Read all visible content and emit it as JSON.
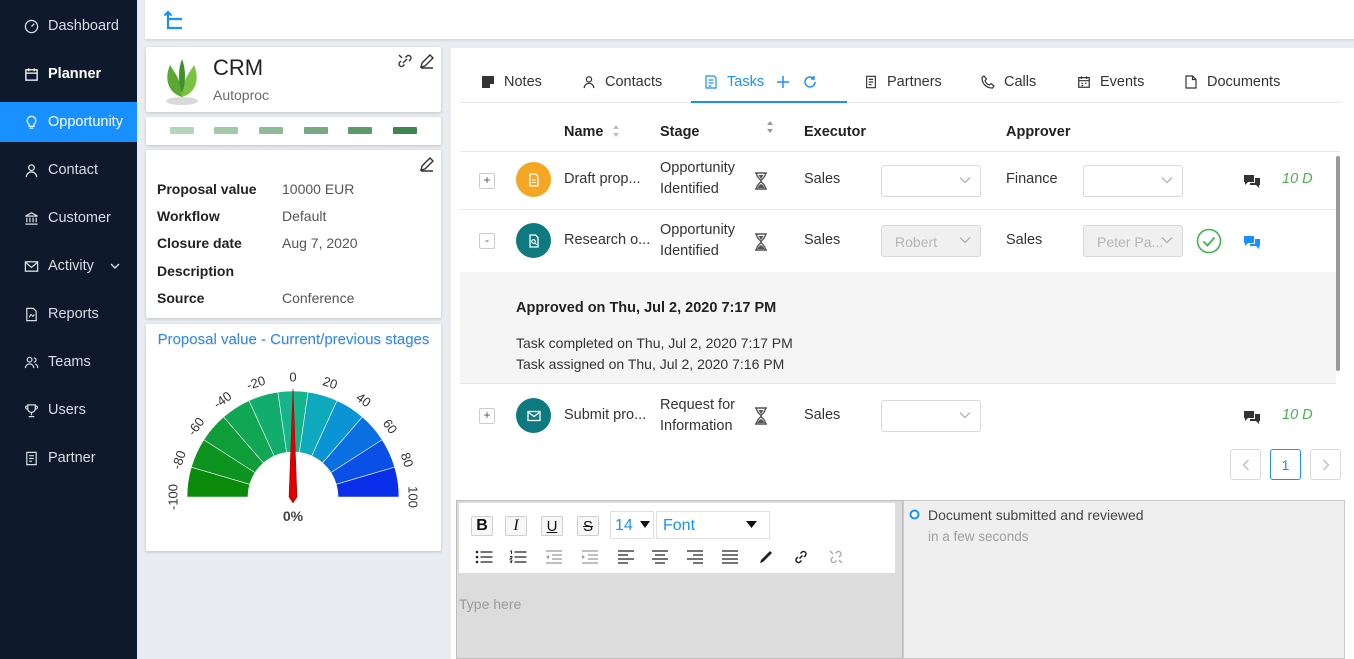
{
  "sidebar": {
    "items": [
      {
        "label": "Dashboard",
        "icon": "gauge-icon"
      },
      {
        "label": "Planner",
        "icon": "calendar-icon"
      },
      {
        "label": "Opportunity",
        "icon": "lightbulb-icon"
      },
      {
        "label": "Contact",
        "icon": "person-icon"
      },
      {
        "label": "Customer",
        "icon": "bank-icon"
      },
      {
        "label": "Activity",
        "icon": "mail-icon"
      },
      {
        "label": "Reports",
        "icon": "report-icon"
      },
      {
        "label": "Teams",
        "icon": "team-icon"
      },
      {
        "label": "Users",
        "icon": "trophy-icon"
      },
      {
        "label": "Partner",
        "icon": "partner-icon"
      }
    ],
    "active": "Opportunity"
  },
  "opportunity": {
    "title": "CRM",
    "subtitle": "Autoproc",
    "stage_colors": [
      "#b4d4bc",
      "#a3c9ac",
      "#8fbb9b",
      "#76a984",
      "#5c9a6c",
      "#3f8452"
    ],
    "details": [
      {
        "key": "Proposal value",
        "value": "10000 EUR"
      },
      {
        "key": "Workflow",
        "value": "Default"
      },
      {
        "key": "Closure date",
        "value": "Aug 7, 2020"
      },
      {
        "key": "Description",
        "value": ""
      },
      {
        "key": "Source",
        "value": "Conference"
      }
    ]
  },
  "gauge": {
    "title": "Proposal value - Current/previous stages",
    "min": -100,
    "max": 100,
    "ticks": [
      "-100",
      "-80",
      "-60",
      "-40",
      "-20",
      "0",
      "20",
      "40",
      "60",
      "80",
      "100"
    ],
    "value": 0,
    "value_label": "0%",
    "segment_colors": [
      "#0a8a0a",
      "#0d9420",
      "#0f9d3a",
      "#10a653",
      "#12ad6e",
      "#14b58a",
      "#0fa9bd",
      "#0a94d4",
      "#0a6fe0",
      "#0a4fe6",
      "#0a2fea"
    ]
  },
  "tabs": [
    {
      "label": "Notes",
      "icon": "note-icon"
    },
    {
      "label": "Contacts",
      "icon": "person-icon"
    },
    {
      "label": "Tasks",
      "icon": "task-icon"
    },
    {
      "label": "Partners",
      "icon": "partner-icon"
    },
    {
      "label": "Calls",
      "icon": "phone-icon"
    },
    {
      "label": "Events",
      "icon": "calendar-icon"
    },
    {
      "label": "Documents",
      "icon": "document-icon"
    }
  ],
  "active_tab": "Tasks",
  "table": {
    "columns": {
      "name": "Name",
      "stage": "Stage",
      "executor": "Executor",
      "approver": "Approver"
    },
    "rows": [
      {
        "expander": "+",
        "avatar_color": "#f5a623",
        "avatar_icon": "document-icon",
        "name": "Draft prop...",
        "stage_line1": "Opportunity",
        "stage_line2": "Identified",
        "executor_team": "Sales",
        "executor_user": "",
        "approver_team": "Finance",
        "approver_user": "",
        "due": "10 D"
      },
      {
        "expander": "-",
        "avatar_color": "#0e7a80",
        "avatar_icon": "search-doc-icon",
        "name": "Research o...",
        "stage_line1": "Opportunity",
        "stage_line2": "Identified",
        "executor_team": "Sales",
        "executor_user": "Robert",
        "approver_team": "Sales",
        "approver_user": "Peter Pa...",
        "due": ""
      },
      {
        "expander": "+",
        "avatar_color": "#0e7a80",
        "avatar_icon": "mail-icon",
        "name": "Submit pro...",
        "stage_line1": "Request for",
        "stage_line2": "Information",
        "executor_team": "Sales",
        "executor_user": "",
        "approver_team": "",
        "approver_user": "",
        "due": "10 D"
      }
    ],
    "expanded_detail": {
      "approved": "Approved on Thu, Jul 2, 2020 7:17 PM",
      "completed": "Task completed on Thu, Jul 2, 2020 7:17 PM",
      "assigned": "Task assigned on Thu, Jul 2, 2020 7:16 PM"
    }
  },
  "pagination": {
    "current": "1"
  },
  "editor": {
    "font_size": "14",
    "font": "Font",
    "placeholder": "Type here",
    "bold": "B",
    "italic": "I",
    "underline": "U",
    "strike": "S"
  },
  "timeline": [
    {
      "text": "Document submitted and reviewed",
      "time": "in a few seconds"
    }
  ]
}
